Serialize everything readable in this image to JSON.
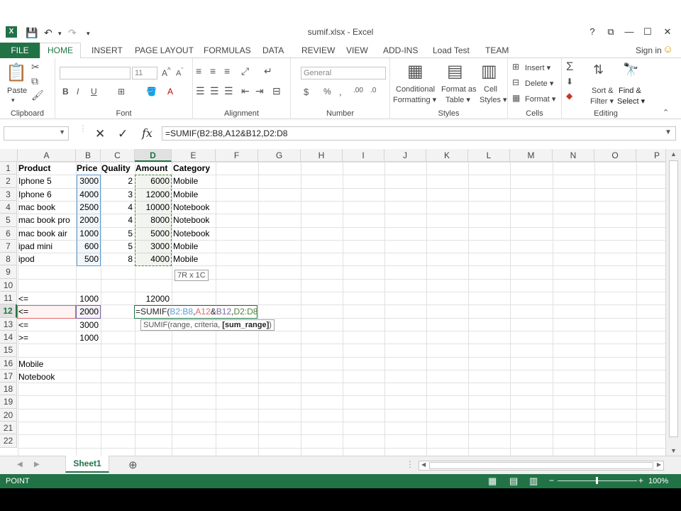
{
  "window": {
    "title": "sumif.xlsx - Excel",
    "controls": [
      "?",
      "⧉",
      "—",
      "☐",
      "✕"
    ]
  },
  "tabs": [
    {
      "label": "FILE"
    },
    {
      "label": "HOME"
    },
    {
      "label": "INSERT"
    },
    {
      "label": "PAGE LAYOUT"
    },
    {
      "label": "FORMULAS"
    },
    {
      "label": "DATA"
    },
    {
      "label": "REVIEW"
    },
    {
      "label": "VIEW"
    },
    {
      "label": "ADD-INS"
    },
    {
      "label": "Load Test"
    },
    {
      "label": "TEAM"
    }
  ],
  "signin": "Sign in",
  "ribbon": {
    "clipboard": {
      "label": "Clipboard",
      "paste": "Paste"
    },
    "font": {
      "label": "Font",
      "size": "11",
      "bold": "B",
      "italic": "I",
      "underline": "U"
    },
    "alignment": {
      "label": "Alignment"
    },
    "number": {
      "label": "Number",
      "format": "General"
    },
    "styles": {
      "label": "Styles",
      "conditional": "Conditional",
      "formatting": "Formatting ▾",
      "format_as": "Format as",
      "table": "Table ▾",
      "cell": "Cell",
      "cell_styles": "Styles ▾"
    },
    "cells": {
      "label": "Cells",
      "insert": "Insert ▾",
      "delete": "Delete ▾",
      "format": "Format ▾"
    },
    "editing": {
      "label": "Editing",
      "sort": "Sort &",
      "filter": "Filter ▾",
      "find": "Find &",
      "select": "Select ▾"
    }
  },
  "formula_bar": {
    "fx": "fx",
    "value": "=SUMIF(B2:B8,A12&B12,D2:D8"
  },
  "columns": [
    "A",
    "B",
    "C",
    "D",
    "E",
    "F",
    "G",
    "H",
    "I",
    "J",
    "K",
    "L",
    "M",
    "N",
    "O",
    "P"
  ],
  "rows": [
    "1",
    "2",
    "3",
    "4",
    "5",
    "6",
    "7",
    "8",
    "9",
    "10",
    "11",
    "12",
    "13",
    "14",
    "15",
    "16",
    "17",
    "18",
    "19",
    "20",
    "21",
    "22"
  ],
  "table": {
    "headers": {
      "a": "Product",
      "b": "Price",
      "c": "Quality",
      "d": "Amount",
      "e": "Category"
    },
    "rows": [
      {
        "a": "Iphone 5",
        "b": "3000",
        "c": "2",
        "d": "6000",
        "e": "Mobile"
      },
      {
        "a": "Iphone 6",
        "b": "4000",
        "c": "3",
        "d": "12000",
        "e": "Mobile"
      },
      {
        "a": "mac book",
        "b": "2500",
        "c": "4",
        "d": "10000",
        "e": "Notebook"
      },
      {
        "a": "mac book pro",
        "b": "2000",
        "c": "4",
        "d": "8000",
        "e": "Notebook"
      },
      {
        "a": "mac book air",
        "b": "1000",
        "c": "5",
        "d": "5000",
        "e": "Notebook"
      },
      {
        "a": "ipad mini",
        "b": "600",
        "c": "5",
        "d": "3000",
        "e": "Mobile"
      },
      {
        "a": "ipod",
        "b": "500",
        "c": "8",
        "d": "4000",
        "e": "Mobile"
      }
    ]
  },
  "criteria": [
    {
      "a": "<=",
      "b": "1000",
      "d": "12000"
    },
    {
      "a": "<=",
      "b": "2000"
    },
    {
      "a": "<=",
      "b": "3000"
    },
    {
      "a": ">=",
      "b": "1000"
    }
  ],
  "labels": {
    "mobile": "Mobile",
    "notebook": "Notebook"
  },
  "edit_cell": {
    "prefix": "=SUMIF(",
    "range1": "B2:B8",
    "comma1": ",",
    "ref_a": "A12",
    "amp": "&",
    "ref_b": "B12",
    "comma2": ",",
    "range2": "D2:D8"
  },
  "tooltip_size": "7R x 1C",
  "tooltip_func": {
    "name": "SUMIF(range, criteria, ",
    "bold": "[sum_range]",
    "close": ")"
  },
  "sheet_tab": "Sheet1",
  "status": {
    "mode": "POINT",
    "zoom": "100%"
  },
  "colors": {
    "excel_green": "#217346",
    "range_blue": "#5b9bd5",
    "range_green": "#548235",
    "ref_red": "#e06666",
    "ref_purple": "#8064a2"
  }
}
